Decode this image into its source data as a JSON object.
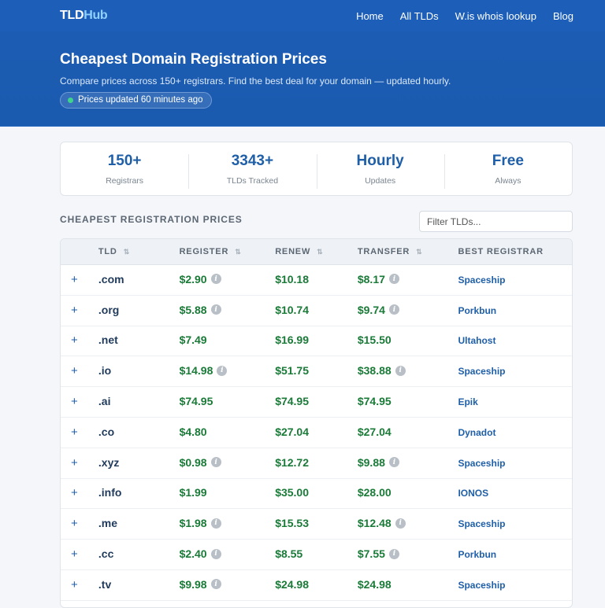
{
  "nav": {
    "logo_main": "TLD",
    "logo_accent": "Hub",
    "links": [
      "Home",
      "All TLDs",
      "W.is whois lookup",
      "Blog"
    ]
  },
  "hero": {
    "title": "Cheapest Domain Registration Prices",
    "subtitle": "Compare prices across 150+ registrars. Find the best deal for your domain — updated hourly.",
    "badge": "Prices updated 60 minutes ago",
    "badge_dot_color": "#3ed48b"
  },
  "stats": [
    {
      "value": "150+",
      "label": "Registrars"
    },
    {
      "value": "3343+",
      "label": "TLDs Tracked"
    },
    {
      "value": "Hourly",
      "label": "Updates"
    },
    {
      "value": "Free",
      "label": "Always"
    }
  ],
  "section_title": "CHEAPEST REGISTRATION PRICES",
  "filter": {
    "placeholder": "Filter TLDs..."
  },
  "table": {
    "headers": [
      "TLD",
      "REGISTER",
      "RENEW",
      "TRANSFER",
      "BEST REGISTRAR"
    ],
    "sort_icon": "sort-icon",
    "expand_symbol": "+",
    "rows": [
      {
        "tld": ".com",
        "register": "$2.90",
        "register_info": true,
        "renew": "$10.18",
        "transfer": "$8.17",
        "transfer_info": true,
        "registrar": "Spaceship"
      },
      {
        "tld": ".org",
        "register": "$5.88",
        "register_info": true,
        "renew": "$10.74",
        "transfer": "$9.74",
        "transfer_info": true,
        "registrar": "Porkbun"
      },
      {
        "tld": ".net",
        "register": "$7.49",
        "register_info": false,
        "renew": "$16.99",
        "transfer": "$15.50",
        "transfer_info": false,
        "registrar": "Ultahost"
      },
      {
        "tld": ".io",
        "register": "$14.98",
        "register_info": true,
        "renew": "$51.75",
        "transfer": "$38.88",
        "transfer_info": true,
        "registrar": "Spaceship"
      },
      {
        "tld": ".ai",
        "register": "$74.95",
        "register_info": false,
        "renew": "$74.95",
        "transfer": "$74.95",
        "transfer_info": false,
        "registrar": "Epik"
      },
      {
        "tld": ".co",
        "register": "$4.80",
        "register_info": false,
        "renew": "$27.04",
        "transfer": "$27.04",
        "transfer_info": false,
        "registrar": "Dynadot"
      },
      {
        "tld": ".xyz",
        "register": "$0.98",
        "register_info": true,
        "renew": "$12.72",
        "transfer": "$9.88",
        "transfer_info": true,
        "registrar": "Spaceship"
      },
      {
        "tld": ".info",
        "register": "$1.99",
        "register_info": false,
        "renew": "$35.00",
        "transfer": "$28.00",
        "transfer_info": false,
        "registrar": "IONOS"
      },
      {
        "tld": ".me",
        "register": "$1.98",
        "register_info": true,
        "renew": "$15.53",
        "transfer": "$12.48",
        "transfer_info": true,
        "registrar": "Spaceship"
      },
      {
        "tld": ".cc",
        "register": "$2.40",
        "register_info": true,
        "renew": "$8.55",
        "transfer": "$7.55",
        "transfer_info": true,
        "registrar": "Porkbun"
      },
      {
        "tld": ".tv",
        "register": "$9.98",
        "register_info": true,
        "renew": "$24.98",
        "transfer": "$24.98",
        "transfer_info": false,
        "registrar": "Spaceship"
      }
    ]
  },
  "colors": {
    "brand_blue": "#1d5fb8",
    "price_green": "#1a7a38",
    "link_blue": "#1f5fa8"
  }
}
